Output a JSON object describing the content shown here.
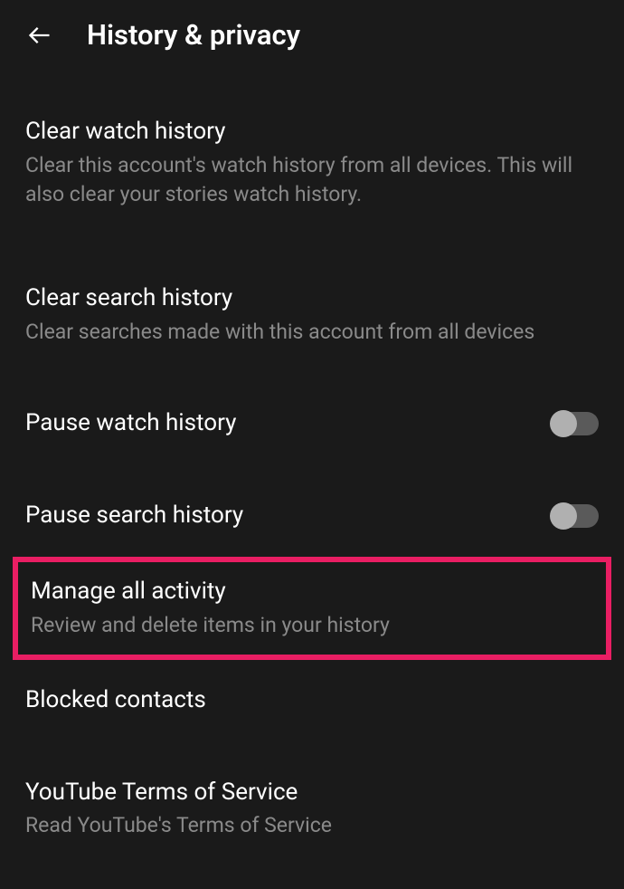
{
  "header": {
    "title": "History & privacy"
  },
  "settings": {
    "clearWatchHistory": {
      "title": "Clear watch history",
      "description": "Clear this account's watch history from all devices. This will also clear your stories watch history."
    },
    "clearSearchHistory": {
      "title": "Clear search history",
      "description": "Clear searches made with this account from all devices"
    },
    "pauseWatchHistory": {
      "title": "Pause watch history"
    },
    "pauseSearchHistory": {
      "title": "Pause search history"
    },
    "manageAllActivity": {
      "title": "Manage all activity",
      "description": "Review and delete items in your history"
    },
    "blockedContacts": {
      "title": "Blocked contacts"
    },
    "youtubeTerms": {
      "title": "YouTube Terms of Service",
      "description": "Read YouTube's Terms of Service"
    }
  }
}
